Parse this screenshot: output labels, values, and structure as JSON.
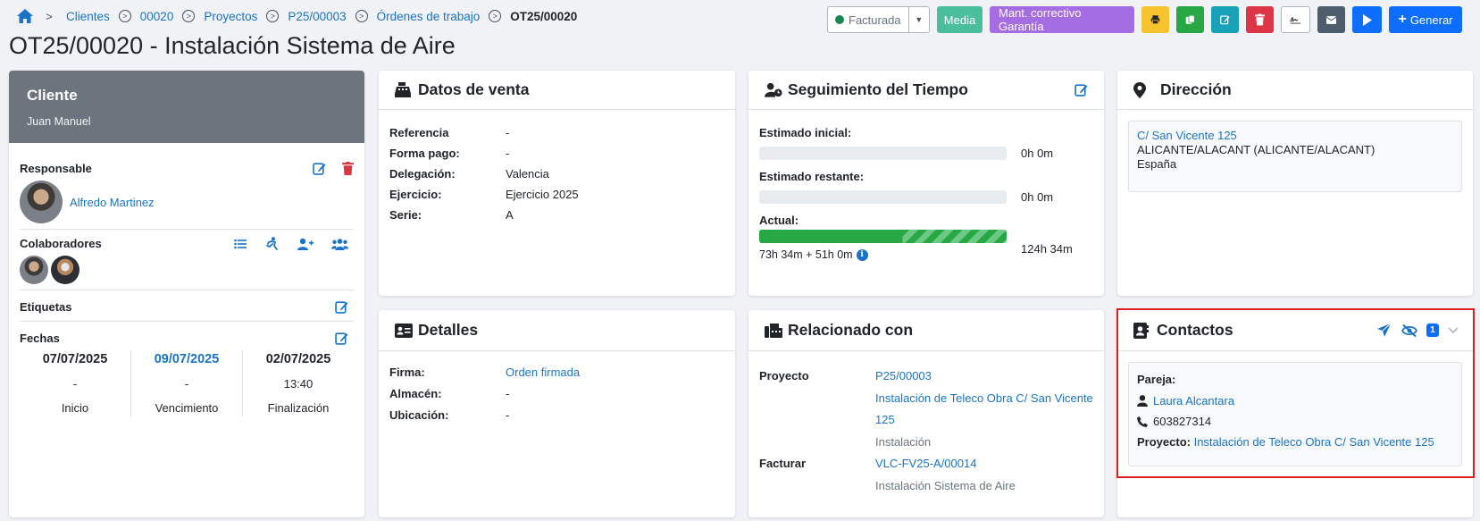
{
  "breadcrumb": {
    "items": [
      "Clientes",
      "00020",
      "Proyectos",
      "P25/00003",
      "Órdenes de trabajo"
    ],
    "current": "OT25/00020"
  },
  "toolbar": {
    "status": "Facturada",
    "priority": "Media",
    "category": "Mant. correctivo Garantía",
    "generate": "Generar"
  },
  "colors": {
    "primary": "#0d6efd",
    "teal": "#4bbf9c",
    "purple": "#a56de2",
    "warning": "#f7c32e",
    "success": "#28a745",
    "info": "#17a2b8",
    "danger": "#dc3545",
    "dark": "#4e5d6c"
  },
  "page_title": "OT25/00020 - Instalación Sistema de Aire",
  "client": {
    "heading": "Cliente",
    "name": "Juan Manuel",
    "responsable_label": "Responsable",
    "responsable_name": "Alfredo Martinez",
    "colaboradores_label": "Colaboradores",
    "etiquetas_label": "Etiquetas",
    "fechas_label": "Fechas",
    "dates": [
      {
        "date": "07/07/2025",
        "time": "-",
        "label": "Inicio"
      },
      {
        "date": "09/07/2025",
        "time": "-",
        "label": "Vencimiento"
      },
      {
        "date": "02/07/2025",
        "time": "13:40",
        "label": "Finalización"
      }
    ]
  },
  "sales": {
    "title": "Datos de venta",
    "rows": [
      {
        "k": "Referencia",
        "v": "-"
      },
      {
        "k": "Forma pago:",
        "v": "-"
      },
      {
        "k": "Delegación:",
        "v": "Valencia"
      },
      {
        "k": "Ejercicio:",
        "v": "Ejercicio 2025"
      },
      {
        "k": "Serie:",
        "v": "A"
      }
    ]
  },
  "time": {
    "title": "Seguimiento del Tiempo",
    "initial_label": "Estimado inicial:",
    "initial_value": "0h 0m",
    "initial_progress": 0,
    "remaining_label": "Estimado restante:",
    "remaining_value": "0h 0m",
    "remaining_progress": 0,
    "actual_label": "Actual:",
    "actual_value": "124h 34m",
    "actual_progress": 1.0,
    "actual_breakdown": "73h 34m + 51h 0m"
  },
  "address": {
    "title": "Dirección",
    "line1": "C/ San Vicente 125",
    "line2": "ALICANTE/ALACANT (ALICANTE/ALACANT)",
    "line3": "España"
  },
  "details": {
    "title": "Detalles",
    "rows": [
      {
        "k": "Firma:",
        "v": "Orden firmada"
      },
      {
        "k": "Almacén:",
        "v": "-"
      },
      {
        "k": "Ubicación:",
        "v": "-"
      }
    ]
  },
  "related": {
    "title": "Relacionado con",
    "proyecto_label": "Proyecto",
    "proyecto_code": "P25/00003",
    "proyecto_name_1": "Instalación de Teleco Obra C/ San Vicente",
    "proyecto_name_2": "125",
    "proyecto_type": "Instalación",
    "facturar_label": "Facturar",
    "factura_code": "VLC-FV25-A/00014",
    "factura_name": "Instalación Sistema de Aire"
  },
  "contacts": {
    "title": "Contactos",
    "count": "1",
    "relation": "Pareja:",
    "name": "Laura Alcantara",
    "phone": "603827314",
    "project_label": "Proyecto:",
    "project_name": "Instalación de Teleco Obra C/ San Vicente 125"
  }
}
